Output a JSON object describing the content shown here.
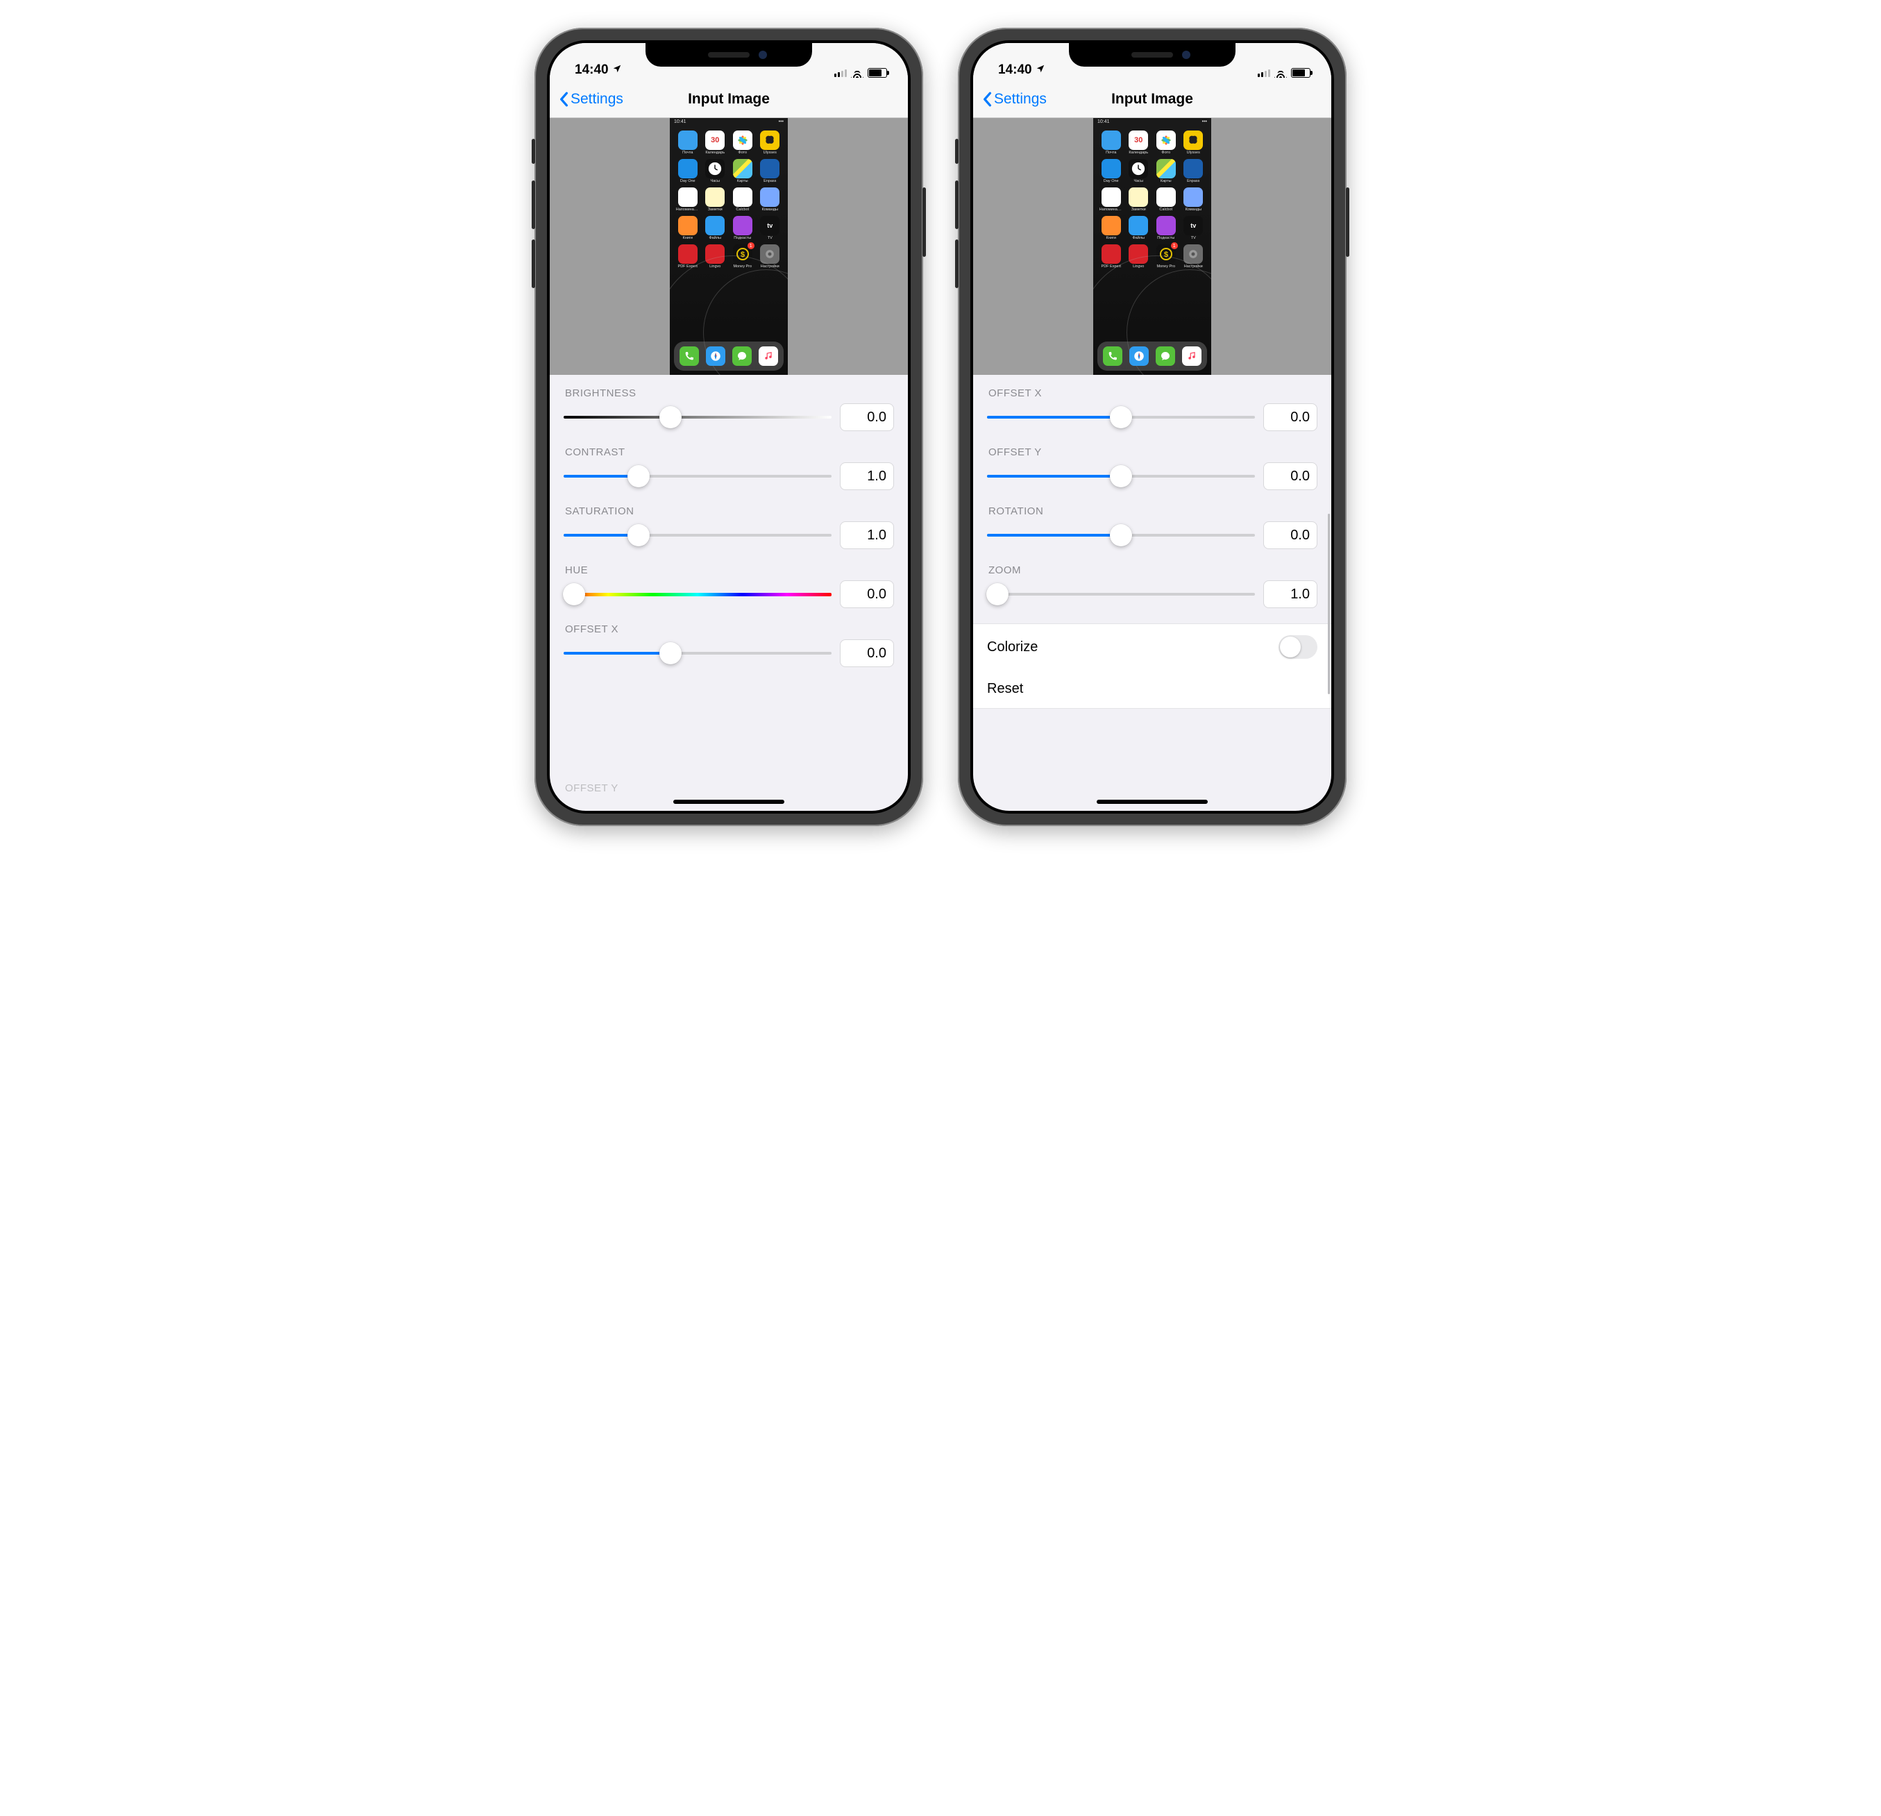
{
  "status": {
    "time": "14:40",
    "nav_icon": "location"
  },
  "nav": {
    "back_label": "Settings",
    "title": "Input Image"
  },
  "preview": {
    "mini_time": "10:41",
    "apps_row1": [
      {
        "label": "Почта",
        "color": "#39a0ed"
      },
      {
        "label": "Календарь",
        "color": "#ffffff",
        "text": "30"
      },
      {
        "label": "Фото",
        "color": "#ffffff",
        "flower": true
      },
      {
        "label": "Ulysses",
        "color": "#f6c800",
        "butterfly": true
      }
    ],
    "apps_row2": [
      {
        "label": "Day One",
        "color": "#1e8fe6"
      },
      {
        "label": "Часы",
        "color": "#111",
        "clock": true
      },
      {
        "label": "Карты",
        "color": "#ffffff",
        "map": true
      },
      {
        "label": "Enpass",
        "color": "#1c5fae"
      }
    ],
    "apps_row3": [
      {
        "label": "Напоминания",
        "color": "#ffffff"
      },
      {
        "label": "Заметки",
        "color": "#fff7c5"
      },
      {
        "label": "Calcbot",
        "color": "#ffffff"
      },
      {
        "label": "Команды",
        "color": "#7aa8ff"
      }
    ],
    "apps_row4": [
      {
        "label": "Книги",
        "color": "#ff8c2e"
      },
      {
        "label": "Файлы",
        "color": "#2f9df0"
      },
      {
        "label": "Подкасты",
        "color": "#a648e0"
      },
      {
        "label": "TV",
        "color": "#111",
        "tv": true
      }
    ],
    "apps_row5": [
      {
        "label": "PDF Expert",
        "color": "#d8232a"
      },
      {
        "label": "Lingvo",
        "color": "#d8232a"
      },
      {
        "label": "Money Pro",
        "color": "#111",
        "dollar": true,
        "badge": true
      },
      {
        "label": "Настройки",
        "color": "#6c6c6c",
        "gear": true
      }
    ],
    "dock": [
      {
        "color": "#57c23b",
        "phone": true
      },
      {
        "color": "#2f9df0",
        "compass": true
      },
      {
        "color": "#57c23b",
        "bubble": true
      },
      {
        "color": "#ffffff",
        "music": true
      }
    ]
  },
  "phone_left": {
    "sliders": [
      {
        "key": "brightness",
        "label": "BRIGHTNESS",
        "value": "0.0",
        "pos": 40,
        "rail": "brightness",
        "fill": null
      },
      {
        "key": "contrast",
        "label": "CONTRAST",
        "value": "1.0",
        "pos": 28,
        "fill": 28
      },
      {
        "key": "saturation",
        "label": "SATURATION",
        "value": "1.0",
        "pos": 28,
        "fill": 28
      },
      {
        "key": "hue",
        "label": "HUE",
        "value": "0.0",
        "pos": 4,
        "rail": "hue",
        "fill": null
      },
      {
        "key": "offset_x",
        "label": "OFFSET X",
        "value": "0.0",
        "pos": 40,
        "fill": 40
      }
    ],
    "peek_label": "OFFSET Y"
  },
  "phone_right": {
    "sliders": [
      {
        "key": "offset_x",
        "label": "OFFSET X",
        "value": "0.0",
        "pos": 50,
        "fill": 50
      },
      {
        "key": "offset_y",
        "label": "OFFSET Y",
        "value": "0.0",
        "pos": 50,
        "fill": 50
      },
      {
        "key": "rotation",
        "label": "ROTATION",
        "value": "0.0",
        "pos": 50,
        "fill": 50
      },
      {
        "key": "zoom",
        "label": "ZOOM",
        "value": "1.0",
        "pos": 4,
        "fill": null
      }
    ],
    "rows": [
      {
        "key": "colorize",
        "label": "Colorize",
        "type": "toggle",
        "on": false
      },
      {
        "key": "reset",
        "label": "Reset",
        "type": "button"
      }
    ]
  }
}
